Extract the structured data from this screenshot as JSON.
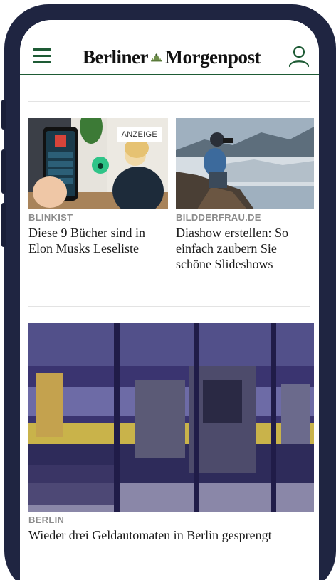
{
  "header": {
    "logo_left": "Berliner",
    "logo_right": "Morgenpost",
    "menu_icon": "hamburger-icon",
    "user_icon": "user-icon",
    "accent_color": "#1e5b35"
  },
  "teasers": [
    {
      "source": "BLINKIST",
      "headline": "Diese 9 Bücher sind in Elon Musks Leseliste",
      "badge": "ANZEIGE"
    },
    {
      "source": "BILDDERFRAU.DE",
      "headline": "Diashow erstellen: So einfach zaubern Sie schöne Slideshows"
    }
  ],
  "lead": {
    "source": "BERLIN",
    "headline": "Wieder drei Geldautomaten in Berlin gesprengt"
  }
}
